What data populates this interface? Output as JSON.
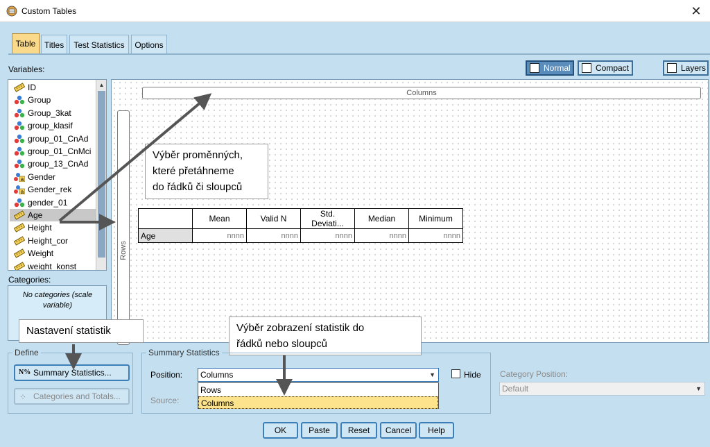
{
  "window": {
    "title": "Custom Tables",
    "close_glyph": "✕"
  },
  "tabs": [
    "Table",
    "Titles",
    "Test Statistics",
    "Options"
  ],
  "labels": {
    "variables": "Variables:",
    "categories": "Categories:"
  },
  "view_buttons": {
    "normal": "Normal",
    "compact": "Compact",
    "layers": "Layers"
  },
  "variables": [
    {
      "name": "ID",
      "type": "scale"
    },
    {
      "name": "Group",
      "type": "nominal"
    },
    {
      "name": "Group_3kat",
      "type": "nominal"
    },
    {
      "name": "group_klasif",
      "type": "nominal"
    },
    {
      "name": "group_01_CnAd",
      "type": "nominal"
    },
    {
      "name": "group_01_CnMci",
      "type": "nominal"
    },
    {
      "name": "group_13_CnAd",
      "type": "nominal"
    },
    {
      "name": "Gender",
      "type": "nominal-string"
    },
    {
      "name": "Gender_rek",
      "type": "nominal-string"
    },
    {
      "name": "gender_01",
      "type": "nominal"
    },
    {
      "name": "Age",
      "type": "scale"
    },
    {
      "name": "Height",
      "type": "scale"
    },
    {
      "name": "Height_cor",
      "type": "scale"
    },
    {
      "name": "Weight",
      "type": "scale"
    },
    {
      "name": "weight_konst",
      "type": "scale"
    }
  ],
  "selected_variable": "Age",
  "categories_text": "No categories (scale variable)",
  "canvas": {
    "columns_label": "Columns",
    "rows_label": "Rows",
    "table": {
      "headers": [
        "Mean",
        "Valid N",
        "Std. Deviati...",
        "Median",
        "Minimum"
      ],
      "row_label": "Age",
      "cells": [
        "nnnn",
        "nnnn",
        "nnnn",
        "nnnn",
        "nnnn"
      ]
    }
  },
  "callouts": {
    "variables_drag": [
      "Výběr proměnných,",
      "které přetáhneme",
      "do řádků či sloupců"
    ],
    "settings": "Nastavení statistik",
    "position": [
      "Výběr zobrazení statistik do",
      "řádků nebo sloupců"
    ]
  },
  "define": {
    "title": "Define",
    "summary_button": "Summary Statistics...",
    "categories_button": "Categories and Totals..."
  },
  "summary_stats": {
    "title": "Summary Statistics",
    "position_label": "Position:",
    "position_value": "Columns",
    "source_label": "Source:",
    "options": [
      "Rows",
      "Columns"
    ],
    "highlighted_option": "Columns",
    "hide_label": "Hide"
  },
  "category_position": {
    "label": "Category Position:",
    "value": "Default"
  },
  "buttons": {
    "ok": "OK",
    "paste": "Paste",
    "reset": "Reset",
    "cancel": "Cancel",
    "help": "Help"
  },
  "colors": {
    "background": "#c4dff0",
    "active_tab": "#fbd98a",
    "highlight": "#fde38c",
    "arrow": "#555555"
  }
}
